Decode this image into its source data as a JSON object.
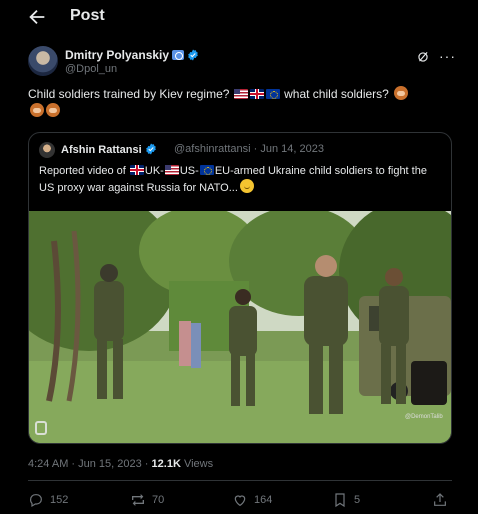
{
  "header": {
    "title": "Post"
  },
  "post": {
    "author_name": "Dmitry Polyanskiy",
    "author_handle": "@Dpol_un",
    "text_part1": "Child soldiers trained by Kiev regime?",
    "text_part2": "what child soldiers?",
    "timestamp": "4:24 AM · Jun 15, 2023",
    "views_count": "12.1K",
    "views_label": "Views"
  },
  "quote": {
    "author_name": "Afshin Rattansi",
    "author_handle_date": "@afshinrattansi · Jun 14, 2023",
    "text_part1": "Reported video of",
    "text_uk": "UK-",
    "text_us": "US-",
    "text_part2": "EU-armed Ukraine child soldiers to fight the US proxy war against Russia for NATO...",
    "watermark": "@DemonTalib"
  },
  "stats": {
    "replies": "152",
    "reposts": "70",
    "likes": "164",
    "bookmarks": "5"
  },
  "colors": {
    "background": "#000000",
    "text": "#e7e9ea",
    "muted": "#71767b",
    "verified": "#1d9bf0",
    "border": "#2f3336"
  },
  "icons": [
    "back-arrow-icon",
    "verified-icon",
    "grok-icon",
    "more-icon",
    "reply-icon",
    "repost-icon",
    "like-icon",
    "bookmark-icon",
    "share-icon"
  ]
}
